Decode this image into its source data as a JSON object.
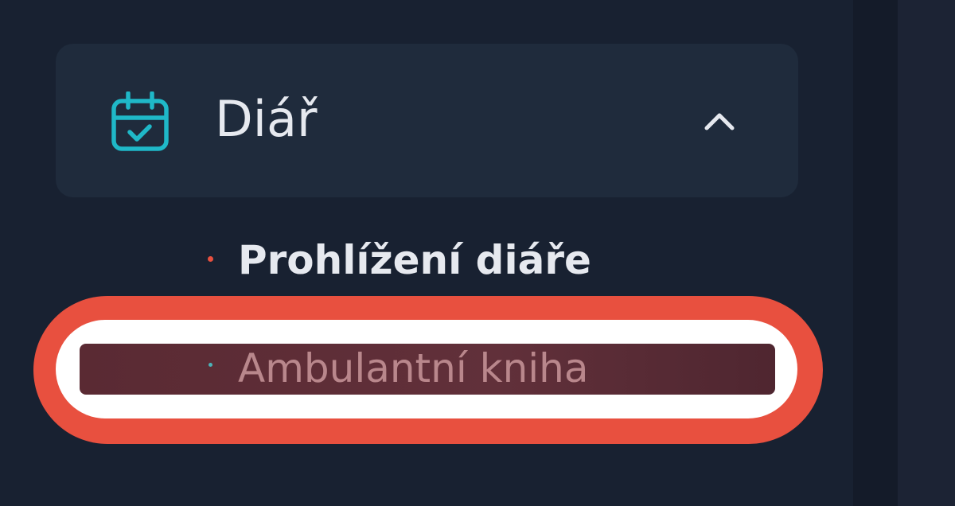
{
  "sidebar": {
    "group": {
      "label": "Diář",
      "icon": "calendar-check-icon",
      "expanded": true,
      "icon_color": "#1fb8c8"
    },
    "items": [
      {
        "label": "Prohlížení diáře",
        "bullet_color": "#e8503f"
      },
      {
        "label": "Ambulantní kniha",
        "bullet_color": "#4bb3b8",
        "highlighted": true
      }
    ]
  },
  "colors": {
    "background": "#182131",
    "group_background": "#1f2b3c",
    "highlight_ring": "#e8503f",
    "text_primary": "#e6e9ef"
  }
}
